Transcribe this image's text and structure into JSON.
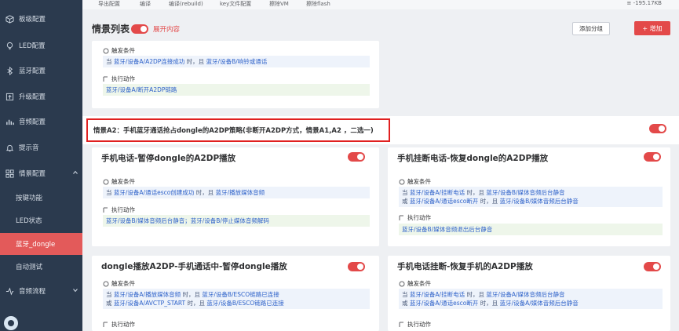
{
  "sidebar": {
    "items": [
      {
        "label": "板级配置",
        "icon": "cube-icon"
      },
      {
        "label": "LED配置",
        "icon": "bulb-icon"
      },
      {
        "label": "蓝牙配置",
        "icon": "bluetooth-icon"
      },
      {
        "label": "升级配置",
        "icon": "upgrade-icon"
      },
      {
        "label": "音频配置",
        "icon": "audio-icon"
      },
      {
        "label": "提示音",
        "icon": "bell-icon"
      },
      {
        "label": "情景配置",
        "icon": "grid-icon"
      },
      {
        "label": "按键功能"
      },
      {
        "label": "LED状态"
      },
      {
        "label": "蓝牙_dongle"
      },
      {
        "label": "自动测试"
      },
      {
        "label": "音频流程",
        "icon": "flow-icon"
      }
    ]
  },
  "toolbar": {
    "items": [
      "导出配置",
      "编译",
      "编译(rebuild)",
      "key文件配置",
      "擦除VM",
      "擦除flash"
    ],
    "speed": "≡ -195.17KB"
  },
  "header": {
    "title": "情景列表",
    "expand_label": "展开内容",
    "add_group_label": "添加分组",
    "add_label": "+ 增加"
  },
  "labels": {
    "trigger": "触发条件",
    "action": "执行动作"
  },
  "top_card": {
    "cond": {
      "pre": "当 ",
      "a": "蓝牙/设备A/A2DP连接成功",
      "mid": " 时，且 ",
      "b": "蓝牙/设备B/响铃或通话"
    },
    "action": "蓝牙/设备A/断开A2DP链路"
  },
  "scene_a2": {
    "text": "情景A2：手机蓝牙通话抢占dongle的A2DP策略(非断开A2DP方式，情景A1,A2 ，二选一)"
  },
  "cards": [
    {
      "title": "手机电话-暂停dongle的A2DP播放",
      "cond": [
        {
          "pre": "当 ",
          "a": "蓝牙/设备A/通话esco创建成功",
          "mid": " 时，且 ",
          "b": "蓝牙/播放媒体音频"
        }
      ],
      "action": "蓝牙/设备B/媒体音频后台静音；蓝牙/设备B/停止媒体音频解码"
    },
    {
      "title": "手机挂断电话-恢复dongle的A2DP播放",
      "cond": [
        {
          "pre": "当 ",
          "a": "蓝牙/设备A/挂断电话",
          "mid": " 时，且 ",
          "b": "蓝牙/设备B/媒体音频后台静音"
        },
        {
          "pre": "或 ",
          "a": "蓝牙/设备A/通话esco断开",
          "mid": " 时，且 ",
          "b": "蓝牙/设备B/媒体音频后台静音"
        }
      ],
      "action": "蓝牙/设备B/媒体音频退出后台静音"
    },
    {
      "title": "dongle播放A2DP-手机通话中-暂停dongle播放",
      "cond": [
        {
          "pre": "当 ",
          "a": "蓝牙/设备A/播放媒体音频",
          "mid": " 时，且 ",
          "b": "蓝牙/设备B/ESCO链路已连接"
        },
        {
          "pre": "或 ",
          "a": "蓝牙/设备A/AVCTP_START",
          "mid": " 时，且 ",
          "b": "蓝牙/设备B/ESCO链路已连接"
        }
      ]
    },
    {
      "title": "手机电话挂断-恢复手机的A2DP播放",
      "cond": [
        {
          "pre": "当 ",
          "a": "蓝牙/设备A/挂断电话",
          "mid": " 时，且 ",
          "b": "蓝牙/设备A/媒体音频后台静音"
        },
        {
          "pre": "或 ",
          "a": "蓝牙/设备A/通话esco断开",
          "mid": " 时，且 ",
          "b": "蓝牙/设备A/媒体音频后台静音"
        }
      ]
    }
  ]
}
